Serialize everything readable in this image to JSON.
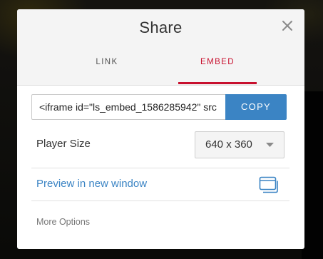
{
  "dialog": {
    "title": "Share",
    "close_icon": "close-icon"
  },
  "tabs": [
    {
      "label": "LINK",
      "active": false
    },
    {
      "label": "EMBED",
      "active": true
    }
  ],
  "embed": {
    "code_value": "<iframe id=\"ls_embed_1586285942\" src",
    "copy_label": "COPY"
  },
  "player_size": {
    "label": "Player Size",
    "selected": "640 x 360",
    "caret_icon": "caret-down-icon"
  },
  "preview": {
    "link_label": "Preview in new window",
    "icon": "new-window-icon"
  },
  "more_options": {
    "label": "More Options"
  },
  "colors": {
    "accent_red": "#c8102e",
    "accent_blue": "#3b84c4",
    "header_bg": "#f4f4f4"
  }
}
